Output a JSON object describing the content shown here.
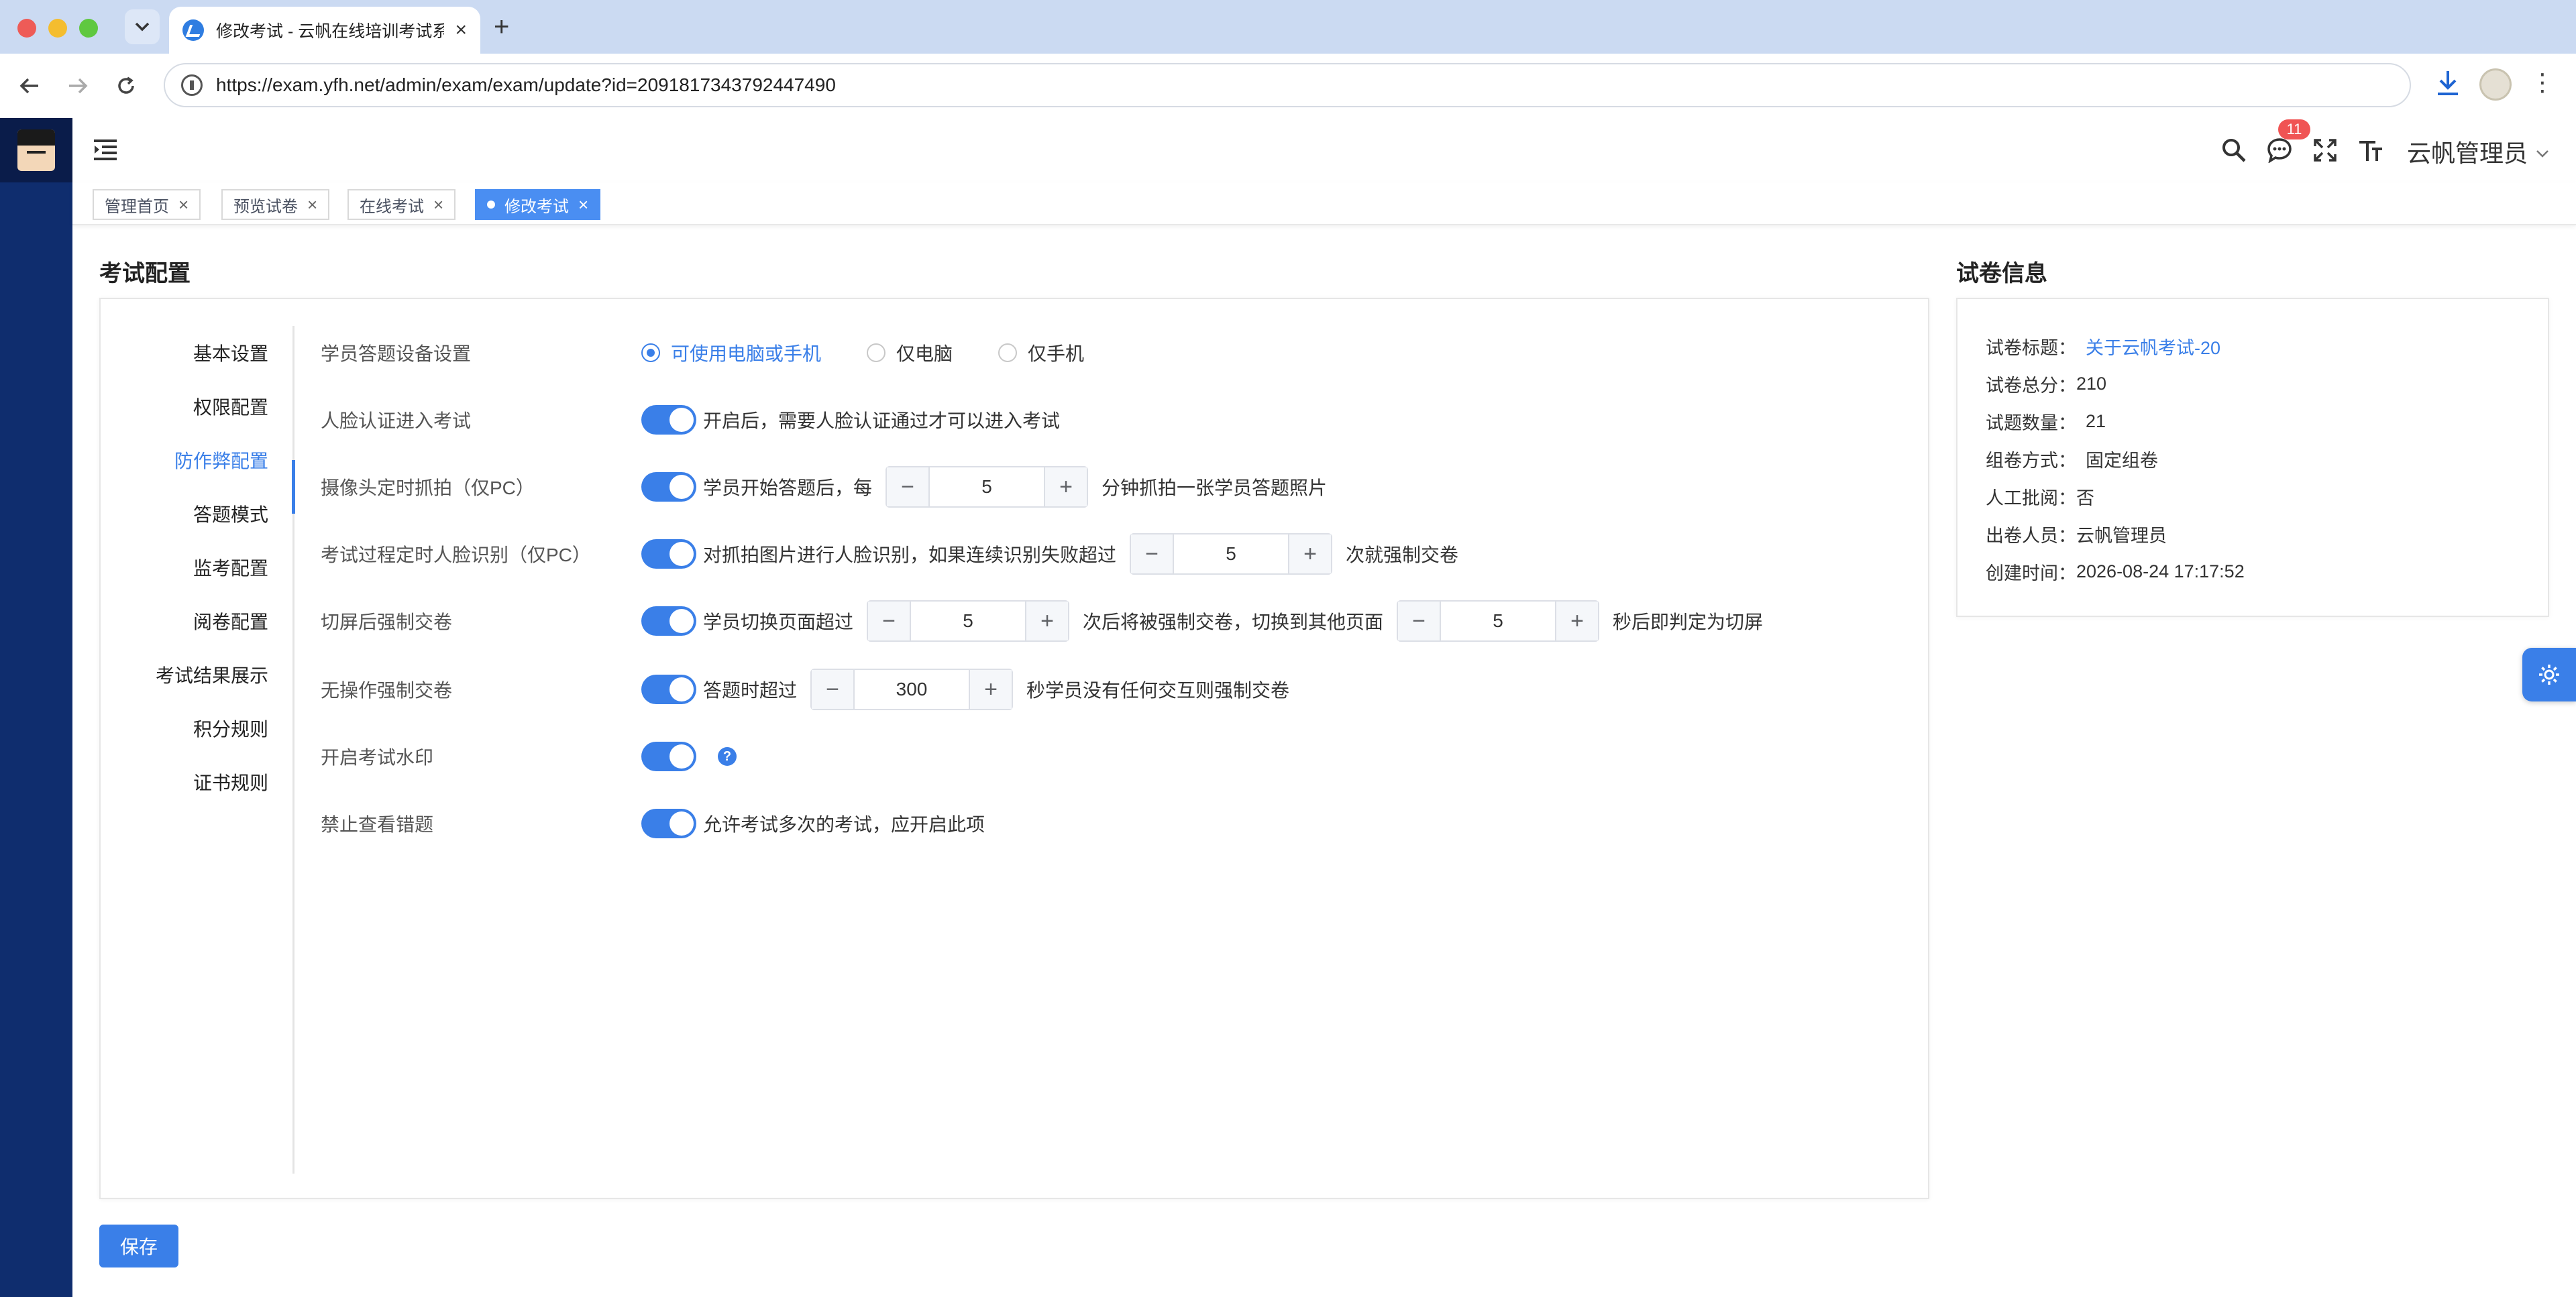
{
  "browser": {
    "tab_title": "修改考试 - 云帆在线培训考试系",
    "url": "https://exam.yfh.net/admin/exam/exam/update?id=2091817343792447490"
  },
  "header": {
    "message_badge": "11",
    "admin_name": "云帆管理员"
  },
  "tags": [
    {
      "label": "管理首页",
      "active": false
    },
    {
      "label": "预览试卷",
      "active": false
    },
    {
      "label": "在线考试",
      "active": false
    },
    {
      "label": "修改考试",
      "active": true
    }
  ],
  "exam_config": {
    "title": "考试配置",
    "menu": [
      {
        "label": "基本设置",
        "active": false
      },
      {
        "label": "权限配置",
        "active": false
      },
      {
        "label": "防作弊配置",
        "active": true
      },
      {
        "label": "答题模式",
        "active": false
      },
      {
        "label": "监考配置",
        "active": false
      },
      {
        "label": "阅卷配置",
        "active": false
      },
      {
        "label": "考试结果展示",
        "active": false
      },
      {
        "label": "积分规则",
        "active": false
      },
      {
        "label": "证书规则",
        "active": false
      }
    ],
    "rows": {
      "device": {
        "label": "学员答题设备设置",
        "options": [
          "可使用电脑或手机",
          "仅电脑",
          "仅手机"
        ],
        "selected": "可使用电脑或手机"
      },
      "face_auth": {
        "label": "人脸认证进入考试",
        "enabled": true,
        "text": "开启后，需要人脸认证通过才可以进入考试"
      },
      "camera": {
        "label": "摄像头定时抓拍（仅PC）",
        "enabled": true,
        "prefix": "学员开始答题后，每",
        "value": "5",
        "suffix": "分钟抓拍一张学员答题照片"
      },
      "face_recog": {
        "label": "考试过程定时人脸识别（仅PC）",
        "enabled": true,
        "prefix": "对抓拍图片进行人脸识别，如果连续识别失败超过",
        "value": "5",
        "suffix": "次就强制交卷"
      },
      "switch_screen": {
        "label": "切屏后强制交卷",
        "enabled": true,
        "prefix": "学员切换页面超过",
        "value1": "5",
        "middle": "次后将被强制交卷，切换到其他页面",
        "value2": "5",
        "suffix": "秒后即判定为切屏"
      },
      "idle": {
        "label": "无操作强制交卷",
        "enabled": true,
        "prefix": "答题时超过",
        "value": "300",
        "suffix": "秒学员没有任何交互则强制交卷"
      },
      "watermark": {
        "label": "开启考试水印",
        "enabled": true,
        "help": "?"
      },
      "no_wrong": {
        "label": "禁止查看错题",
        "enabled": true,
        "text": "允许考试多次的考试，应开启此项"
      }
    },
    "minus": "−",
    "plus": "+",
    "save_label": "保存"
  },
  "paper_info": {
    "title": "试卷信息",
    "rows": [
      {
        "key": "试卷标题：",
        "value": "关于云帆考试-20",
        "link": true
      },
      {
        "key": "试卷总分：",
        "value": "210",
        "link": false
      },
      {
        "key": "试题数量：",
        "value": "21",
        "link": false
      },
      {
        "key": "组卷方式：",
        "value": "固定组卷",
        "link": false
      },
      {
        "key": "人工批阅：",
        "value": "否",
        "link": false
      },
      {
        "key": "出卷人员：",
        "value": "云帆管理员",
        "link": false
      },
      {
        "key": "创建时间：",
        "value": "2026-08-24 17:17:52",
        "link": false
      }
    ]
  },
  "icons": {
    "back": "arrow-left",
    "forward": "arrow-right",
    "reload": "refresh",
    "search": "magnifier",
    "message": "chat-bubble",
    "fullscreen": "expand",
    "font_size": "text-size",
    "settings": "gear"
  },
  "colors": {
    "primary": "#3a7fe8",
    "rail": "#0f2d6e",
    "badge": "#f05454"
  }
}
